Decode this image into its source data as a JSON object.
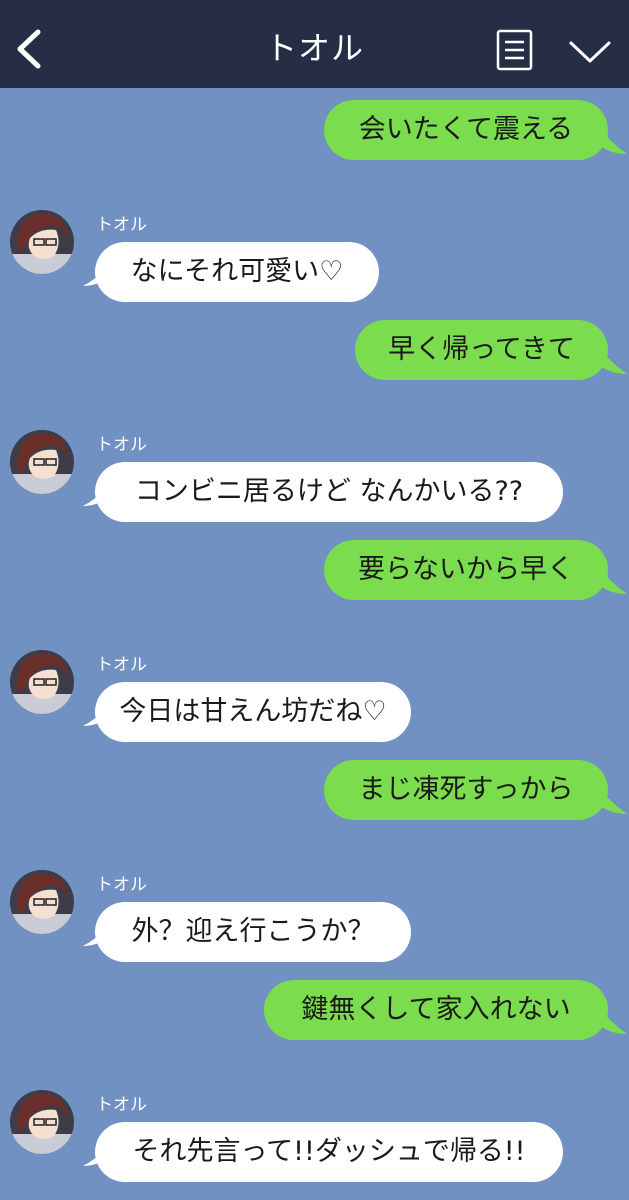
{
  "header": {
    "title": "トオル",
    "back_icon": "chevron-left-icon",
    "menu_icon": "menu-list-icon",
    "collapse_icon": "chevron-down-icon",
    "background": "#252e45"
  },
  "chat": {
    "background": "#7091c1",
    "my_bubble_color": "#7bdc4e",
    "their_bubble_color": "#ffffff",
    "messages": [
      {
        "from": "me",
        "text": "会いたくて震える"
      },
      {
        "from": "them",
        "sender": "トオル",
        "text": "なにそれ可愛い♡"
      },
      {
        "from": "me",
        "text": "早く帰ってきて"
      },
      {
        "from": "them",
        "sender": "トオル",
        "text": "コンビニ居るけど なんかいる??"
      },
      {
        "from": "me",
        "text": "要らないから早く"
      },
      {
        "from": "them",
        "sender": "トオル",
        "text": "今日は甘えん坊だね♡"
      },
      {
        "from": "me",
        "text": "まじ凍死すっから"
      },
      {
        "from": "them",
        "sender": "トオル",
        "text": "外？迎え行こうか？"
      },
      {
        "from": "me",
        "text": "鍵無くして家入れない"
      },
      {
        "from": "them",
        "sender": "トオル",
        "text": "それ先言って!!ダッシュで帰る!!"
      }
    ]
  }
}
